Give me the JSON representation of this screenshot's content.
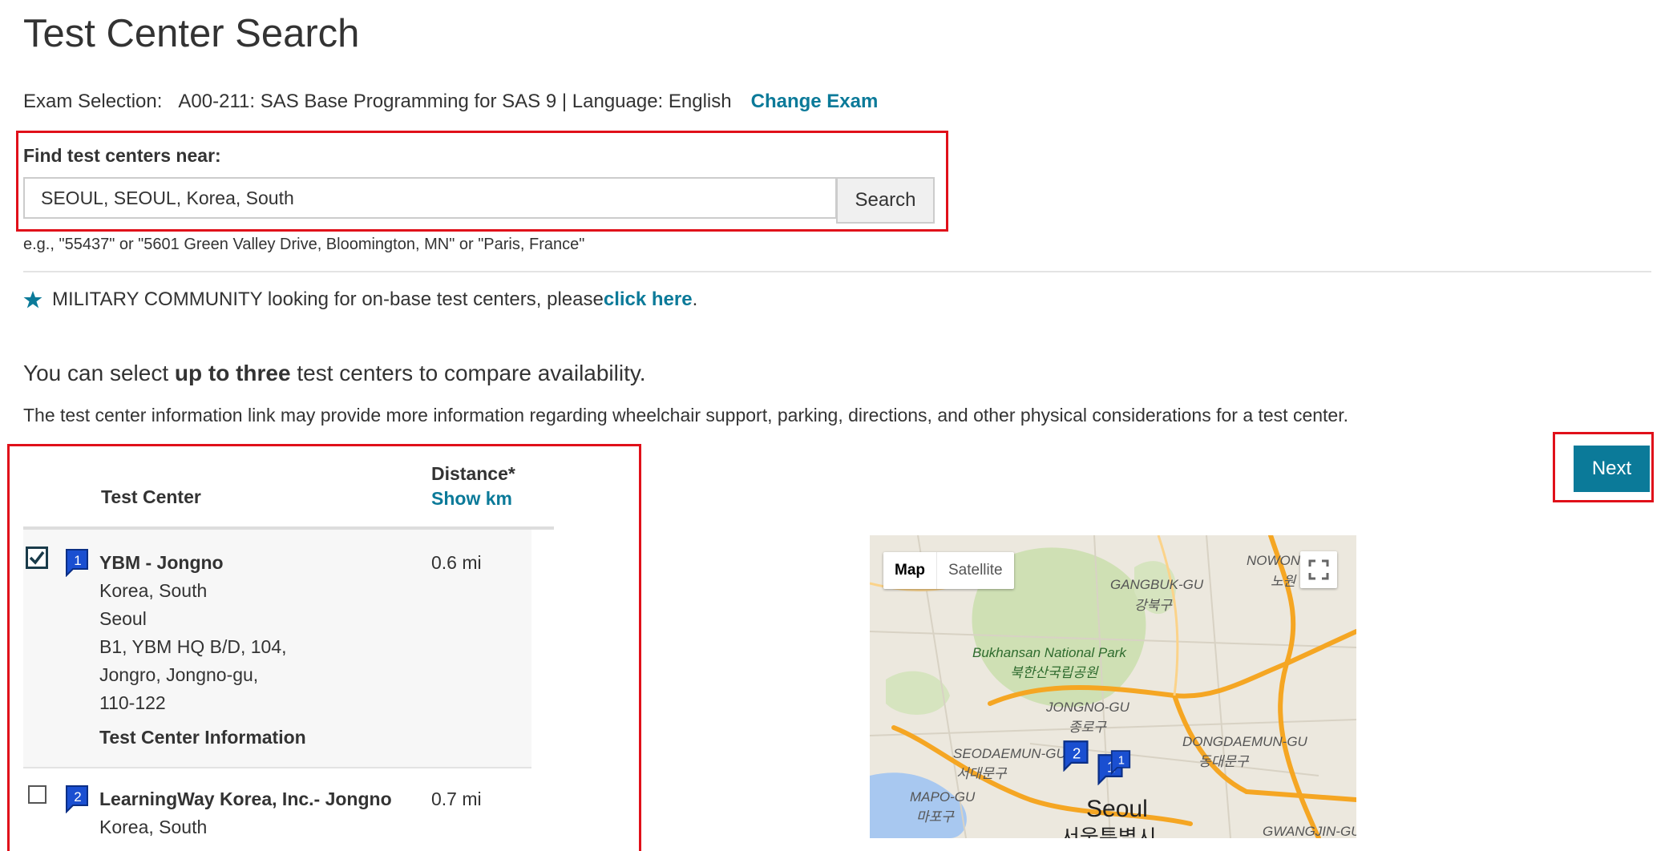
{
  "page_title": "Test Center Search",
  "exam": {
    "label": "Exam Selection:",
    "value": "A00-211: SAS Base Programming for SAS 9 | Language: English",
    "change_link": "Change Exam"
  },
  "search": {
    "label": "Find test centers near:",
    "value": "SEOUL, SEOUL, Korea, South",
    "button": "Search",
    "example": "e.g., \"55437\" or \"5601 Green Valley Drive, Bloomington, MN\" or \"Paris, France\""
  },
  "military": {
    "text": "MILITARY COMMUNITY looking for on-base test centers, please ",
    "link": "click here",
    "suffix": "."
  },
  "intro": {
    "before": "You can select ",
    "bold": "up to three",
    "after": " test centers to compare availability."
  },
  "info_text": "The test center information link may provide more information regarding wheelchair support, parking, directions, and other physical considerations for a test center.",
  "next_button": "Next",
  "table": {
    "col_test_center": "Test Center",
    "col_distance": "Distance*",
    "units_link": "Show km",
    "rows": [
      {
        "marker": "1",
        "checked": true,
        "name": "YBM - Jongno",
        "country": "Korea, South",
        "city": "Seoul",
        "address1": "B1, YBM HQ B/D, 104,",
        "address2": "Jongro, Jongno-gu,",
        "postal": "110-122",
        "info_link": "Test Center Information",
        "distance": "0.6  mi"
      },
      {
        "marker": "2",
        "checked": false,
        "name": "LearningWay Korea, Inc.- Jongno",
        "country": "Korea, South",
        "distance": "0.7  mi"
      }
    ]
  },
  "map": {
    "type_map": "Map",
    "type_satellite": "Satellite",
    "labels": {
      "nowon": "NOWON",
      "nowon_ko": "노원",
      "gangbuk": "GANGBUK-GU",
      "gangbuk_ko": "강북구",
      "park": "Bukhansan National Park",
      "park_ko": "북한산국립공원",
      "jongno": "JONGNO-GU",
      "jongno_ko": "종로구",
      "seodaemun": "SEODAEMUN-GU",
      "seodaemun_ko": "서대문구",
      "dongdaemun": "DONGDAEMUN-GU",
      "dongdaemun_ko": "동대문구",
      "mapo": "MAPO-GU",
      "mapo_ko": "마포구",
      "seoul": "Seoul",
      "seoul_ko": "서울특별시",
      "gwangjin": "GWANGJIN-GU"
    },
    "colors": {
      "park": "#cfe0b4",
      "road_major": "#f5a623",
      "water": "#a8c8f0",
      "marker": "#1a4fd1"
    }
  },
  "highlight_color": "#e0101a",
  "accent_color": "#0b7a99"
}
